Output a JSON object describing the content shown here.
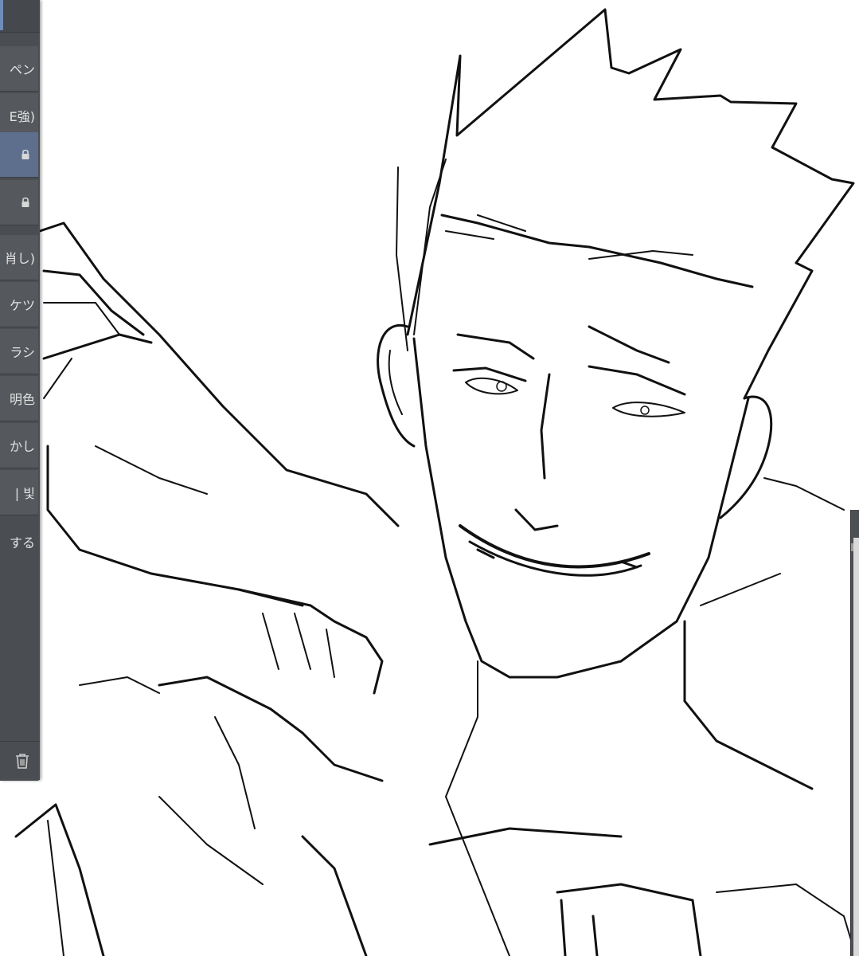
{
  "tool_panel": {
    "items": [
      {
        "label": "ペン",
        "type": "text"
      },
      {
        "label": "E強)",
        "type": "text"
      },
      {
        "label": "",
        "type": "lock",
        "selected": true
      },
      {
        "label": "",
        "type": "lock"
      },
      {
        "label": "肖し)",
        "type": "text"
      },
      {
        "label": "ケツ",
        "type": "text"
      },
      {
        "label": "ラシ",
        "type": "text"
      },
      {
        "label": "明色",
        "type": "text"
      },
      {
        "label": "かし",
        "type": "text"
      },
      {
        "label": "| 빛",
        "type": "text"
      },
      {
        "label": "する",
        "type": "text"
      }
    ],
    "trash_icon": "trash-icon",
    "lock_icon": "lock-icon"
  },
  "canvas": {
    "content": "line-art-sketch"
  },
  "colors": {
    "panel_bg": "#4a4d52",
    "panel_item": "#55585d",
    "panel_selected": "#5e6f8e",
    "panel_text": "#e3e3e3",
    "canvas_bg": "#ffffff",
    "ink": "#111111"
  }
}
